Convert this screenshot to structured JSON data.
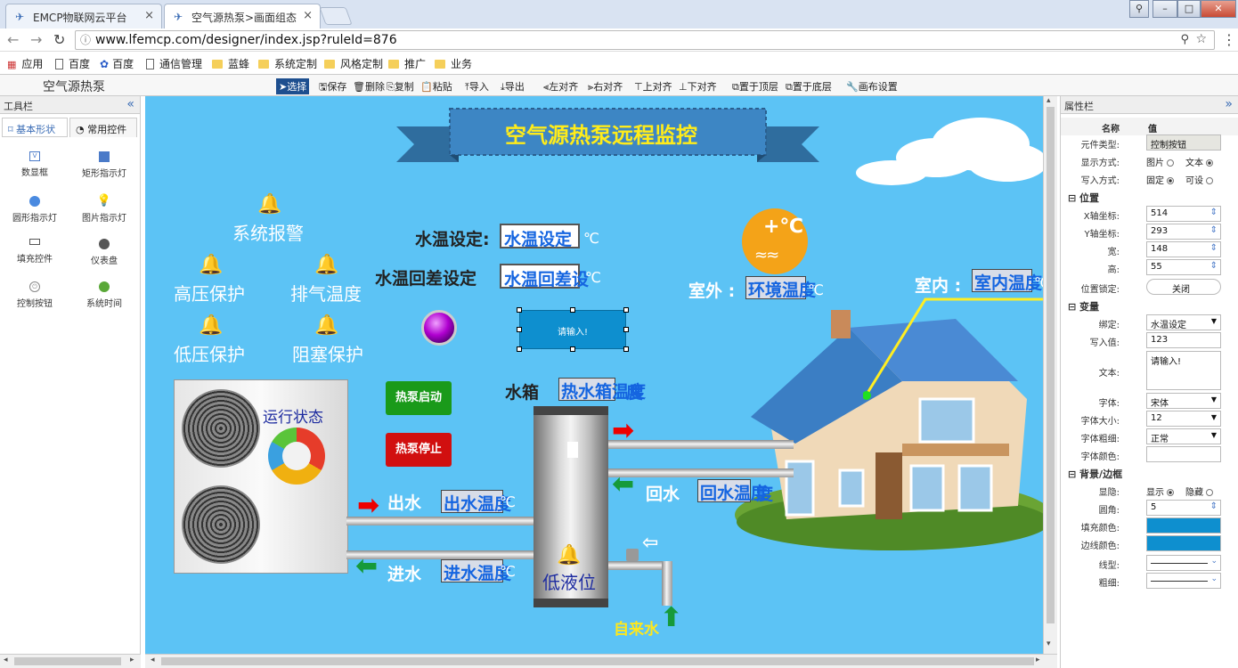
{
  "browser": {
    "tabs": [
      {
        "title": "EMCP物联网云平台",
        "close": "×"
      },
      {
        "title": "空气源热泵>画面组态",
        "close": "×"
      }
    ],
    "url": "www.lfemcp.com/designer/index.jsp?ruleId=876",
    "bookmarks": [
      "应用",
      "百度",
      "百度",
      "通信管理",
      "蓝蜂",
      "系统定制",
      "风格定制",
      "推广",
      "业务"
    ]
  },
  "app": {
    "title": "空气源热泵",
    "toolbar": [
      "选择",
      "保存",
      "删除",
      "复制",
      "粘贴",
      "导入",
      "导出",
      "左对齐",
      "右对齐",
      "上对齐",
      "下对齐",
      "置于顶层",
      "置于底层",
      "画布设置"
    ]
  },
  "left_panel": {
    "title": "工具栏",
    "collapse": "«",
    "tabs": [
      "基本形状",
      "常用控件"
    ],
    "items": [
      "数显框",
      "矩形指示灯",
      "圆形指示灯",
      "图片指示灯",
      "填充控件",
      "仪表盘",
      "控制按钮",
      "系统时间"
    ]
  },
  "canvas": {
    "banner": "空气源热泵远程监控",
    "alarms": {
      "system": "系统报警",
      "high_pressure": "高压保护",
      "exhaust_temp": "排气温度",
      "low_pressure": "低压保护",
      "blockage": "阻塞保护",
      "low_level": "低液位"
    },
    "water_temp_set": {
      "label": "水温设定:",
      "value": "水温设定",
      "unit": "℃"
    },
    "water_diff_set": {
      "label": "水温回差设定",
      "value": "水温回差设",
      "unit": "℃"
    },
    "outdoor": {
      "label": "室外 :",
      "value": "环境温度",
      "unit": "℃"
    },
    "indoor": {
      "label": "室内 :",
      "value": "室内温度",
      "unit": "℃"
    },
    "input_placeholder": "请输入!",
    "run_status": "运行状态",
    "start_button": "热泵启动",
    "stop_button": "热泵停止",
    "tank": {
      "label": "水箱",
      "value": "热水箱温度",
      "unit": "度"
    },
    "outlet": {
      "label": "出水",
      "value": "出水温度",
      "unit": "℃"
    },
    "inlet": {
      "label": "进水",
      "value": "进水温度",
      "unit": "℃"
    },
    "return": {
      "label": "回水",
      "value": "回水温度",
      "unit": "度"
    },
    "tap_water": "自来水",
    "weather_icon": "+℃"
  },
  "right_panel": {
    "title": "属性栏",
    "collapse": "»",
    "header": {
      "name": "名称",
      "value": "值"
    },
    "rows": {
      "type": {
        "label": "元件类型:",
        "value": "控制按钮"
      },
      "display": {
        "label": "显示方式:",
        "opt1": "图片",
        "opt2": "文本"
      },
      "write": {
        "label": "写入方式:",
        "opt1": "固定",
        "opt2": "可设"
      },
      "section_position": "位置",
      "x": {
        "label": "X轴坐标:",
        "value": "514"
      },
      "y": {
        "label": "Y轴坐标:",
        "value": "293"
      },
      "w": {
        "label": "宽:",
        "value": "148"
      },
      "h": {
        "label": "高:",
        "value": "55"
      },
      "lock": {
        "label": "位置锁定:",
        "value": "关闭"
      },
      "section_variable": "变量",
      "bind": {
        "label": "绑定:",
        "value": "水温设定"
      },
      "write_value": {
        "label": "写入值:",
        "value": "123"
      },
      "text": {
        "label": "文本:",
        "value": "请输入!"
      },
      "font": {
        "label": "字体:",
        "value": "宋体"
      },
      "font_size": {
        "label": "字体大小:",
        "value": "12"
      },
      "font_weight": {
        "label": "字体粗细:",
        "value": "正常"
      },
      "font_color": {
        "label": "字体颜色:",
        "value": ""
      },
      "section_bg": "背景/边框",
      "visible": {
        "label": "显隐:",
        "opt1": "显示",
        "opt2": "隐藏"
      },
      "radius": {
        "label": "圆角:",
        "value": "5"
      },
      "fill": {
        "label": "填充颜色:",
        "color": "#0e8fcf"
      },
      "border": {
        "label": "边线颜色:",
        "color": "#0e8fcf"
      },
      "line_style": {
        "label": "线型:"
      },
      "line_width": {
        "label": "粗细:"
      }
    }
  },
  "colors": {
    "canvas_bg": "#5cc3f5",
    "accent": "#0e8fcf",
    "alarm": "#e00000",
    "start": "#1a9a1a",
    "stop": "#d10f0f",
    "bind_text": "#1565e0"
  }
}
